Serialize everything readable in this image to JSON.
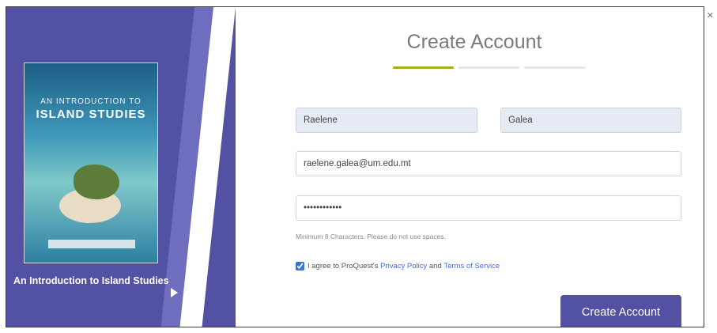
{
  "modal": {
    "title": "Create Account",
    "close_label": "×",
    "steps": [
      {
        "active": true
      },
      {
        "active": false
      },
      {
        "active": false
      }
    ],
    "accent_color": "#5351a3",
    "progress_color": "#a3ad1a"
  },
  "book": {
    "cover_supertitle": "AN INTRODUCTION TO",
    "cover_title": "ISLAND STUDIES",
    "caption": "An Introduction to Island Studies"
  },
  "form": {
    "first_name": "Raelene",
    "last_name": "Galea",
    "email": "raelene.galea@um.edu.mt",
    "password": "••••••••••••",
    "password_hint": "Minimum 8 Characters. Please do not use spaces.",
    "agree_checked": true,
    "agree_text_prefix": "I agree to ProQuest's",
    "privacy_policy_link": "Privacy Policy",
    "agree_and": "and",
    "terms_link": "Terms of Service",
    "submit_label": "Create Account"
  }
}
